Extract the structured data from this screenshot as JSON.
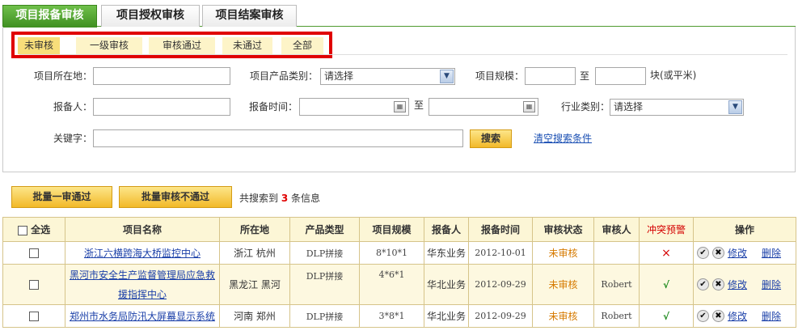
{
  "tabs": [
    {
      "label": "项目报备审核",
      "active": true
    },
    {
      "label": "项目授权审核",
      "active": false
    },
    {
      "label": "项目结案审核",
      "active": false
    }
  ],
  "subtabs": [
    {
      "label": "未审核",
      "active": true
    },
    {
      "label": "一级审核",
      "active": false
    },
    {
      "label": "审核通过",
      "active": false
    },
    {
      "label": "未通过",
      "active": false
    },
    {
      "label": "全部",
      "active": false
    }
  ],
  "form": {
    "location_label": "项目所在地：",
    "category_label": "项目产品类别：",
    "category_value": "请选择",
    "scale_label": "项目规模：",
    "scale_to": "至",
    "scale_unit": "块(或平米)",
    "reporter_label": "报备人：",
    "time_label": "报备时间：",
    "time_to": "至",
    "industry_label": "行业类别：",
    "industry_value": "请选择",
    "keyword_label": "关键字：",
    "search_button": "搜索",
    "clear_link": "清空搜索条件"
  },
  "actions": {
    "batch_pass": "批量一审通过",
    "batch_reject": "批量审核不通过",
    "result_prefix": "共搜索到",
    "result_count": "3",
    "result_suffix": "条信息"
  },
  "table": {
    "headers": [
      "全选",
      "项目名称",
      "所在地",
      "产品类型",
      "项目规模",
      "报备人",
      "报备时间",
      "审核状态",
      "审核人",
      "冲突预警",
      "操作"
    ],
    "rows": [
      {
        "name": "浙江六横跨海大桥监控中心",
        "location": "浙江 杭州",
        "type": "DLP拼接",
        "scale": "8*10*1",
        "reporter": "华东业务",
        "time": "2012-10-01",
        "status": "未审核",
        "auditor": "",
        "conflict": "×",
        "edit": "修改",
        "delete": "删除"
      },
      {
        "name": "黑河市安全生产监督管理局应急救援指挥中心",
        "location": "黑龙江 黑河",
        "type": "DLP拼接",
        "scale": "4*6*1",
        "reporter": "华北业务",
        "time": "2012-09-29",
        "status": "未审核",
        "auditor": "Robert",
        "conflict": "√",
        "edit": "修改",
        "delete": "删除"
      },
      {
        "name": "郑州市水务局防汛大屏幕显示系统",
        "location": "河南 郑州",
        "type": "DLP拼接",
        "scale": "3*8*1",
        "reporter": "华北业务",
        "time": "2012-09-29",
        "status": "未审核",
        "auditor": "Robert",
        "conflict": "√",
        "edit": "修改",
        "delete": "删除"
      }
    ]
  }
}
